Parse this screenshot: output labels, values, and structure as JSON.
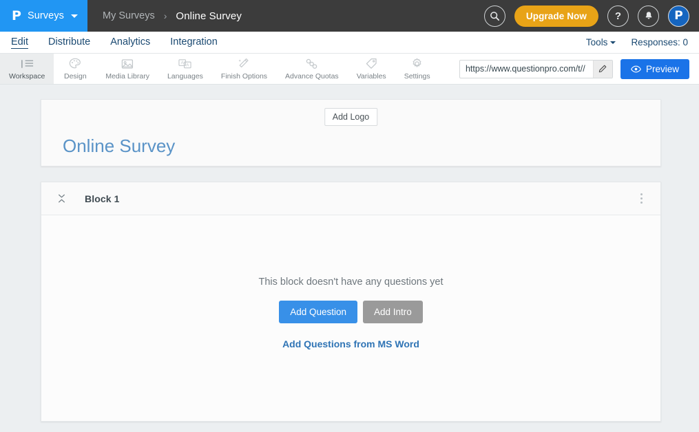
{
  "header": {
    "brand_logo_glyph": "P",
    "brand_label": "Surveys",
    "breadcrumb_parent": "My Surveys",
    "breadcrumb_separator": "›",
    "breadcrumb_current": "Online Survey",
    "search_icon": "search-icon",
    "upgrade_label": "Upgrade Now",
    "help_glyph": "?",
    "notification_icon": "bell-icon",
    "avatar_glyph": "P",
    "bar_color": "#3c3c3c",
    "brand_color": "#2196f3",
    "upgrade_color": "#e8a317"
  },
  "nav": {
    "tabs": [
      {
        "label": "Edit",
        "active": true
      },
      {
        "label": "Distribute",
        "active": false
      },
      {
        "label": "Analytics",
        "active": false
      },
      {
        "label": "Integration",
        "active": false
      }
    ],
    "tools_label": "Tools",
    "responses_label": "Responses: 0",
    "link_color": "#1a4971"
  },
  "toolbar": {
    "items": [
      {
        "label": "Workspace",
        "icon": "workspace-icon",
        "active": true
      },
      {
        "label": "Design",
        "icon": "palette-icon",
        "active": false
      },
      {
        "label": "Media Library",
        "icon": "image-icon",
        "active": false
      },
      {
        "label": "Languages",
        "icon": "translate-icon",
        "active": false
      },
      {
        "label": "Finish Options",
        "icon": "magic-wand-icon",
        "active": false
      },
      {
        "label": "Advance Quotas",
        "icon": "chain-link-icon",
        "active": false
      },
      {
        "label": "Variables",
        "icon": "tag-icon",
        "active": false
      },
      {
        "label": "Settings",
        "icon": "gear-icon",
        "active": false
      }
    ],
    "survey_url": "https://www.questionpro.com/t//",
    "edit_icon": "pencil-icon",
    "preview_label": "Preview",
    "preview_icon": "eye-icon",
    "preview_color": "#1a73e8"
  },
  "survey": {
    "add_logo_label": "Add Logo",
    "title": "Online Survey",
    "title_color": "#5a93c7"
  },
  "block": {
    "collapse_icon": "collapse-expand-icon",
    "title": "Block 1",
    "menu_icon": "kebab-menu-icon",
    "empty_message": "This block doesn't have any questions yet",
    "add_question_label": "Add Question",
    "add_intro_label": "Add Intro",
    "ms_word_link": "Add Questions from MS Word",
    "primary_color": "#3890e8",
    "secondary_color": "#9a9a9a",
    "link_color": "#2f74b5"
  }
}
